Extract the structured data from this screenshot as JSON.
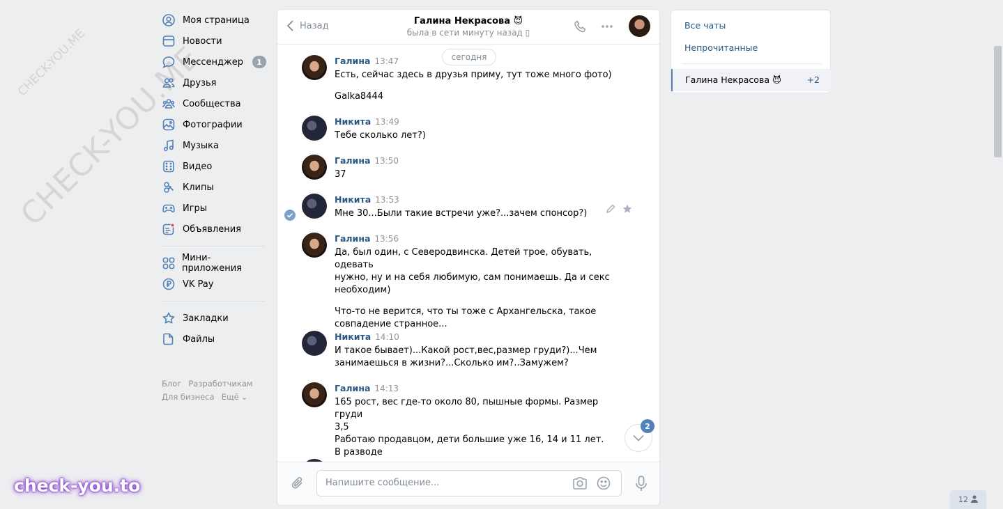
{
  "nav": {
    "items": [
      {
        "label": "Моя страница",
        "icon": "user-circle-icon"
      },
      {
        "label": "Новости",
        "icon": "news-icon"
      },
      {
        "label": "Мессенджер",
        "icon": "message-icon",
        "badge": "1"
      },
      {
        "label": "Друзья",
        "icon": "friends-icon"
      },
      {
        "label": "Сообщества",
        "icon": "communities-icon"
      },
      {
        "label": "Фотографии",
        "icon": "photo-icon"
      },
      {
        "label": "Музыка",
        "icon": "music-icon"
      },
      {
        "label": "Видео",
        "icon": "video-icon"
      },
      {
        "label": "Клипы",
        "icon": "clips-icon"
      },
      {
        "label": "Игры",
        "icon": "gamepad-icon"
      },
      {
        "label": "Объявления",
        "icon": "classifieds-icon"
      }
    ],
    "items2": [
      {
        "label": "Мини-приложения",
        "icon": "apps-icon"
      },
      {
        "label": "VK Pay",
        "icon": "vkpay-icon"
      }
    ],
    "items3": [
      {
        "label": "Закладки",
        "icon": "star-icon"
      },
      {
        "label": "Файлы",
        "icon": "file-icon"
      }
    ],
    "footer": {
      "blog": "Блог",
      "dev": "Разработчикам",
      "business": "Для бизнеса",
      "more": "Ещё"
    }
  },
  "chat": {
    "back_label": "Назад",
    "peer_name": "Галина Некрасова 😈",
    "peer_status": "была в сети минуту назад",
    "date_label": "сегодня",
    "messages": [
      {
        "author": "Галина",
        "time": "13:47",
        "lines": [
          "Есть, сейчас здесь в друзья приму, тут тоже много фото)"
        ],
        "extra": [
          "Galka8444"
        ]
      },
      {
        "author": "Никита",
        "time": "13:49",
        "lines": [
          "Тебе сколько лет?)"
        ]
      },
      {
        "author": "Галина",
        "time": "13:50",
        "lines": [
          "37"
        ]
      },
      {
        "author": "Никита",
        "time": "13:53",
        "lines": [
          "Мне 30...Были такие встречи уже?...зачем спонсор?)"
        ]
      },
      {
        "author": "Галина",
        "time": "13:56",
        "lines": [
          "Да, был один, с Северодвинска. Детей трое, обувать, одевать",
          "нужно, ну и на себя любимую, сам понимаешь. Да и секс",
          "необходим)"
        ],
        "extra": [
          "Что-то не верится, что ты тоже с Архангельска, такое",
          "совпадение странное..."
        ]
      },
      {
        "author": "Никита",
        "time": "14:10",
        "lines": [
          "И такое бывает)...Какой рост,вес,размер груди?)...Чем",
          "занимаешься в жизни?...Сколько им?..Замужем?"
        ]
      },
      {
        "author": "Галина",
        "time": "14:13",
        "lines": [
          "165 рост, вес где-то около 80, пышные формы. Размер груди",
          "3,5",
          "Работаю продавцом, дети большие уже 16, 14 и 11 лет.",
          "В разводе"
        ]
      }
    ],
    "unread_badge": "2",
    "composer_placeholder": "Напишите сообщение..."
  },
  "right": {
    "all_chats": "Все чаты",
    "unread": "Непрочитанные",
    "active_chat": "Галина Некрасова 😈",
    "active_count": "+2"
  },
  "online_count": "12",
  "watermarks": {
    "diag_big": "CHECK-YOU.ME",
    "diag_small": "CHECK-YOU.ME",
    "logo": "check-you.to"
  }
}
